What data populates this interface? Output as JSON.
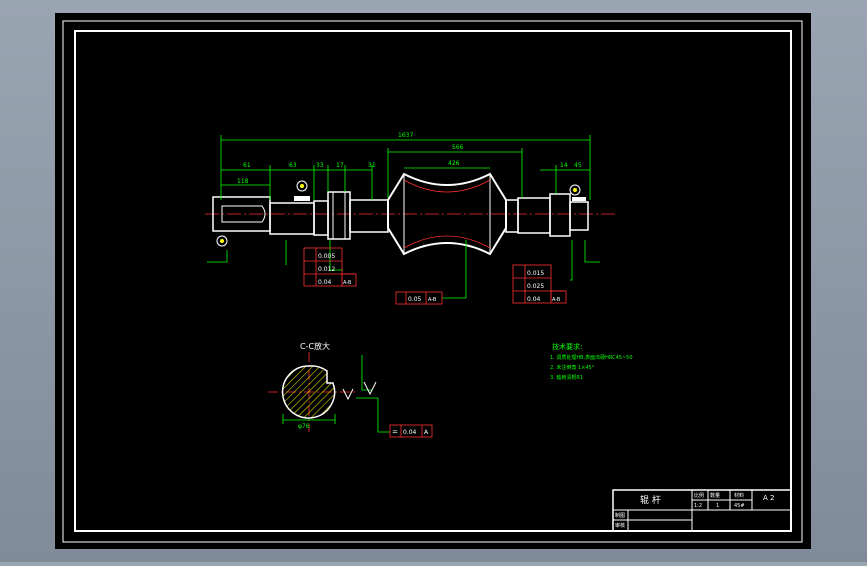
{
  "colors": {
    "background": "#000000",
    "frame": "#ffffff",
    "dimension": "#00ff00",
    "part": "#ffffff",
    "centerline": "#ff3030",
    "hatch": "#ffff00",
    "annotation": "#ff3030",
    "tolerance_text": "#ffffff",
    "notes": "#00ff00",
    "title_text": "#ffffff",
    "chrome": "#8a95a3"
  },
  "icons": {
    "datum_marker": "circle-datum-icon",
    "roughness": "roughness-triangle-icon"
  },
  "dimensions": {
    "overall": "1637",
    "roll_span": "566",
    "roll_body": "426",
    "seg_a": "61",
    "seg_b": "63",
    "seg_c": "33",
    "seg_d": "17",
    "seg_e": "31",
    "seg_f": "14",
    "seg_g": "45",
    "keyway": "118"
  },
  "section": {
    "title": "C-C放大",
    "width_dim": "φ76",
    "tolerance": "0.04",
    "datum": "A"
  },
  "tolerance_blocks": {
    "left": [
      "0.005",
      "0.012",
      "0.04"
    ],
    "right": [
      "0.015",
      "0.025",
      "0.04"
    ],
    "left_datum": "A-B",
    "right_datum": "A-B",
    "center_value": "0.05",
    "center_datum": "A-B"
  },
  "notes": {
    "heading": "技术要求:",
    "items": [
      "1. 调质处理HB,表面淬硬HRC45~50",
      "2. 未注倒角 1×45°",
      "3. 轴肩清根R1"
    ]
  },
  "title_block": {
    "part_name": "辊 杆",
    "col1": "比例",
    "col2": "数量",
    "col3": "材料",
    "scale": "1:2",
    "quantity": "1",
    "material": "45#",
    "sheet": "A 2",
    "drawn_label": "制图",
    "checked_label": "审核"
  }
}
